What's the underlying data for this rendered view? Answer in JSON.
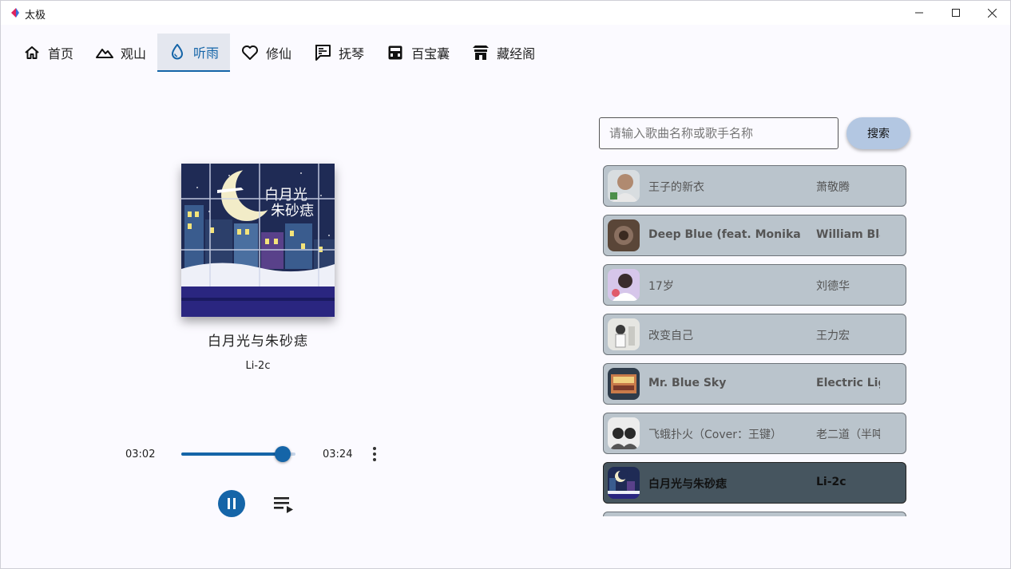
{
  "window": {
    "title": "太极"
  },
  "nav": {
    "tabs": [
      {
        "label": "首页"
      },
      {
        "label": "观山"
      },
      {
        "label": "听雨",
        "active": true
      },
      {
        "label": "修仙"
      },
      {
        "label": "抚琴"
      },
      {
        "label": "百宝囊"
      },
      {
        "label": "藏经阁"
      }
    ]
  },
  "player": {
    "title": "白月光与朱砂痣",
    "artist": "Li-2c",
    "current_time": "03:02",
    "total_time": "03:24",
    "progress": 0.89,
    "state": "playing",
    "accent_color": "#1565a8"
  },
  "search": {
    "placeholder": "请输入歌曲名称或歌手名称",
    "value": "",
    "button_label": "搜索"
  },
  "playlist": {
    "items": [
      {
        "name": "王子的新衣",
        "artist": "萧敬腾"
      },
      {
        "name": "Deep Blue (feat. Monika Santucci)",
        "artist": "William Black"
      },
      {
        "name": "17岁",
        "artist": "刘德华"
      },
      {
        "name": "改变自己",
        "artist": "王力宏"
      },
      {
        "name": "Mr. Blue Sky",
        "artist": "Electric Light Orchestra"
      },
      {
        "name": "飞蛾扑火（Cover：王键）",
        "artist": "老二道（半吨兄弟）"
      },
      {
        "name": "白月光与朱砂痣",
        "artist": "Li-2c",
        "current": true
      }
    ]
  }
}
